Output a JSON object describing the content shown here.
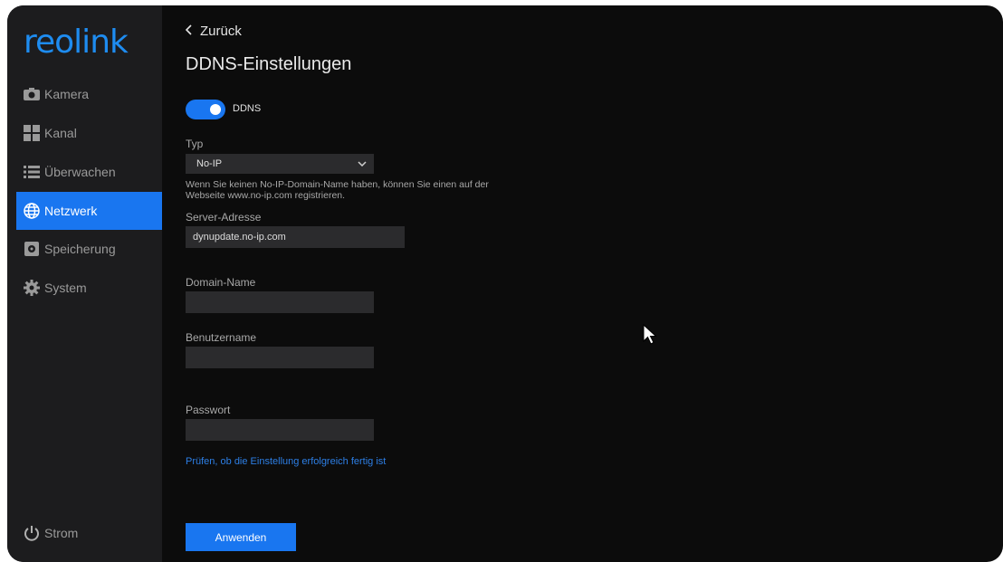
{
  "brand": {
    "logo_text": "reolink"
  },
  "sidebar": {
    "items": [
      {
        "label": "Kamera",
        "icon": "camera-icon"
      },
      {
        "label": "Kanal",
        "icon": "grid-icon"
      },
      {
        "label": "Überwachen",
        "icon": "list-icon"
      },
      {
        "label": "Netzwerk",
        "icon": "globe-icon",
        "active": true
      },
      {
        "label": "Speicherung",
        "icon": "storage-icon"
      },
      {
        "label": "System",
        "icon": "gear-icon"
      }
    ],
    "power_label": "Strom"
  },
  "header": {
    "back_label": "Zurück",
    "title": "DDNS-Einstellungen"
  },
  "ddns": {
    "toggle_label": "DDNS",
    "enabled": true
  },
  "form": {
    "type_label": "Typ",
    "type_value": "No-IP",
    "hint": "Wenn Sie keinen No-IP-Domain-Name haben, können Sie einen auf der Webseite www.no-ip.com registrieren.",
    "server_label": "Server-Adresse",
    "server_value": "dynupdate.no-ip.com",
    "domain_label": "Domain-Name",
    "domain_value": "",
    "user_label": "Benutzername",
    "user_value": "",
    "password_label": "Passwort",
    "password_value": "",
    "check_link": "Prüfen, ob die Einstellung erfolgreich fertig ist",
    "apply_label": "Anwenden"
  },
  "colors": {
    "accent": "#1976f0",
    "sidebar_bg": "#1c1c1e",
    "panel_bg": "#0c0c0c"
  }
}
